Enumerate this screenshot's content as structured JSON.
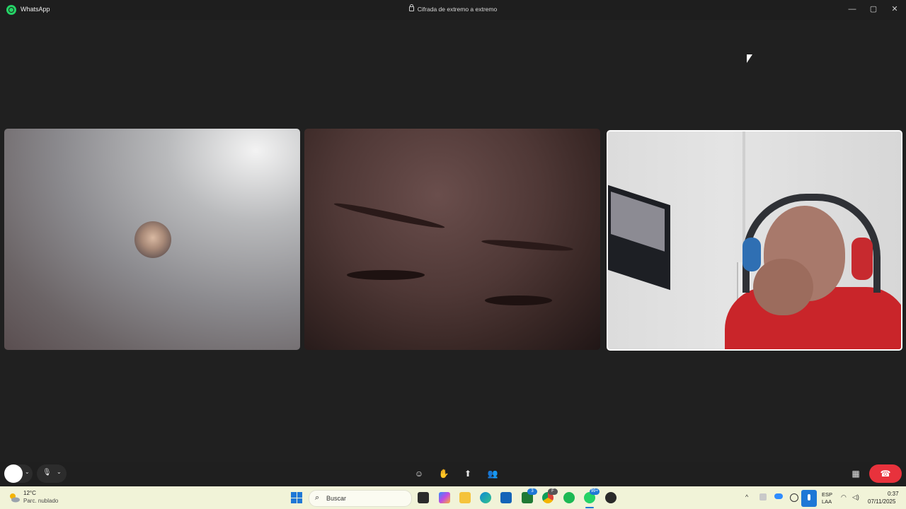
{
  "titlebar": {
    "app_name": "WhatsApp",
    "encryption_text": "Cifrada de extremo a extremo",
    "icon": "whatsapp-logo-icon"
  },
  "window_controls": {
    "minimize": "—",
    "maximize": "▢",
    "close": "✕"
  },
  "participants": [
    {
      "name": "participant-1",
      "video": false,
      "avatar": "avatar-photo"
    },
    {
      "name": "participant-2",
      "video": true
    },
    {
      "name": "participant-3",
      "video": true,
      "active_speaker": true
    }
  ],
  "call_controls": {
    "camera_chevron": "⌄",
    "mic_icon": "🎙",
    "mic_chevron": "⌄",
    "reaction_icon": "☺",
    "raise_hand_icon": "✋",
    "share_screen_icon": "⬆",
    "participants_icon": "👥",
    "layout_icon": "▦",
    "end_call_icon": "☎",
    "colors": {
      "end_call": "#e8323c"
    }
  },
  "taskbar": {
    "weather": {
      "temp": "12°C",
      "desc": "Parc. nublado"
    },
    "search_label": "Buscar",
    "apps": [
      {
        "name": "task-view-icon"
      },
      {
        "name": "copilot-icon"
      },
      {
        "name": "file-explorer-icon"
      },
      {
        "name": "edge-icon"
      },
      {
        "name": "store-icon"
      },
      {
        "name": "xbox-icon",
        "badge": "3"
      },
      {
        "name": "chrome-icon",
        "badge": "F"
      },
      {
        "name": "spotify-icon"
      },
      {
        "name": "whatsapp-icon",
        "badge": "99+"
      },
      {
        "name": "obs-icon"
      }
    ],
    "tray": {
      "chevron": "^",
      "lang_line1": "ESP",
      "lang_line2": "LAA",
      "time": "0:37",
      "date": "07/11/2025"
    }
  }
}
